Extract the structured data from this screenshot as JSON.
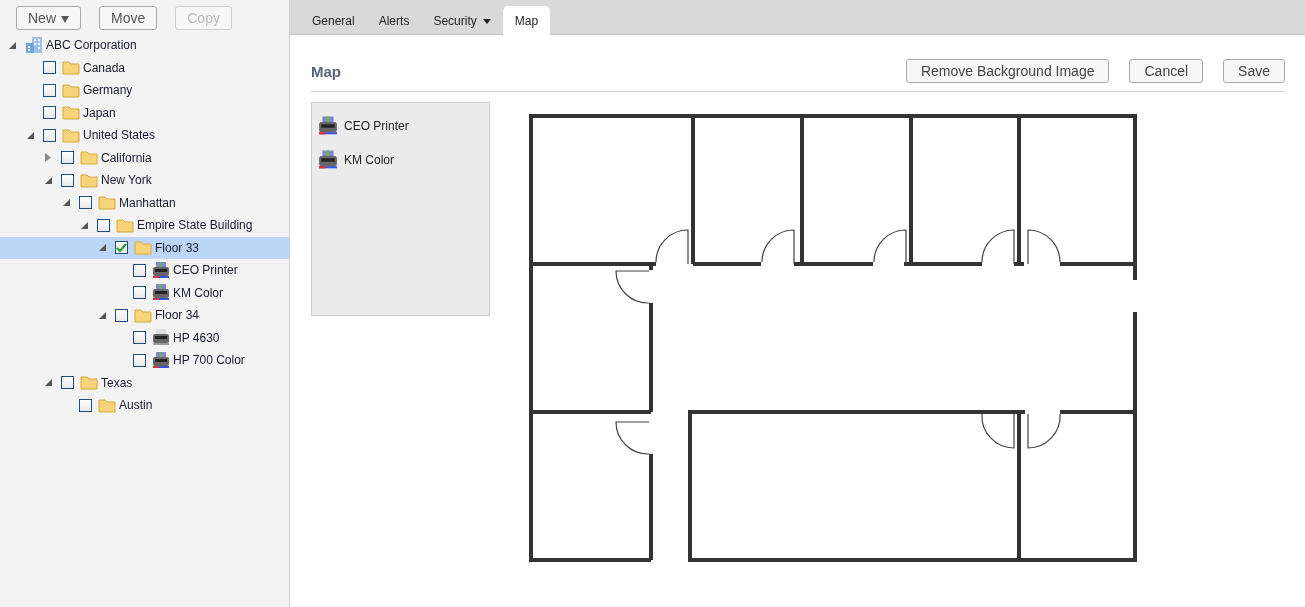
{
  "toolbar": [
    {
      "label": "New",
      "caret": true,
      "disabled": false
    },
    {
      "label": "Move",
      "caret": false,
      "disabled": false
    },
    {
      "label": "Copy",
      "caret": false,
      "disabled": true
    }
  ],
  "tree": [
    {
      "label": "ABC Corporation",
      "kind": "building",
      "expanded": true,
      "children": [
        {
          "label": "Canada",
          "kind": "folder",
          "checked": false,
          "selected": false
        },
        {
          "label": "Germany",
          "kind": "folder",
          "checked": false,
          "selected": false
        },
        {
          "label": "Japan",
          "kind": "folder",
          "checked": false,
          "selected": false
        },
        {
          "label": "United States",
          "kind": "folder",
          "checked": false,
          "selected": false,
          "expanded": true,
          "children": [
            {
              "label": "California",
              "kind": "folder",
              "checked": false,
              "selected": false,
              "expanded": false,
              "has_children": true
            },
            {
              "label": "New York",
              "kind": "folder",
              "checked": false,
              "selected": false,
              "expanded": true,
              "children": [
                {
                  "label": "Manhattan",
                  "kind": "folder",
                  "checked": false,
                  "selected": false,
                  "expanded": true,
                  "children": [
                    {
                      "label": "Empire State Building",
                      "kind": "folder",
                      "checked": false,
                      "selected": false,
                      "expanded": true,
                      "children": [
                        {
                          "label": "Floor 33",
                          "kind": "folder",
                          "checked": true,
                          "selected": true,
                          "expanded": true,
                          "children": [
                            {
                              "label": "CEO Printer",
                              "kind": "color_printer",
                              "checked": false,
                              "selected": false
                            },
                            {
                              "label": "KM Color",
                              "kind": "color_printer",
                              "checked": false,
                              "selected": false
                            }
                          ]
                        },
                        {
                          "label": "Floor 34",
                          "kind": "folder",
                          "checked": false,
                          "selected": false,
                          "expanded": true,
                          "children": [
                            {
                              "label": "HP 4630",
                              "kind": "printer",
                              "checked": false,
                              "selected": false
                            },
                            {
                              "label": "HP 700 Color",
                              "kind": "color_printer",
                              "checked": false,
                              "selected": false
                            }
                          ]
                        }
                      ]
                    }
                  ]
                }
              ]
            },
            {
              "label": "Texas",
              "kind": "folder",
              "checked": false,
              "selected": false,
              "expanded": true,
              "children": [
                {
                  "label": "Austin",
                  "kind": "folder",
                  "checked": false,
                  "selected": false
                }
              ]
            }
          ]
        }
      ]
    }
  ],
  "tabs": [
    {
      "label": "General",
      "selected": false,
      "caret": false
    },
    {
      "label": "Alerts",
      "selected": false,
      "caret": false
    },
    {
      "label": "Security",
      "selected": false,
      "caret": true
    },
    {
      "label": "Map",
      "selected": true,
      "caret": false
    }
  ],
  "map": {
    "title": "Map",
    "buttons": [
      "Remove Background Image",
      "Cancel",
      "Save"
    ],
    "devices": [
      {
        "label": "CEO Printer"
      },
      {
        "label": "KM Color"
      }
    ]
  }
}
